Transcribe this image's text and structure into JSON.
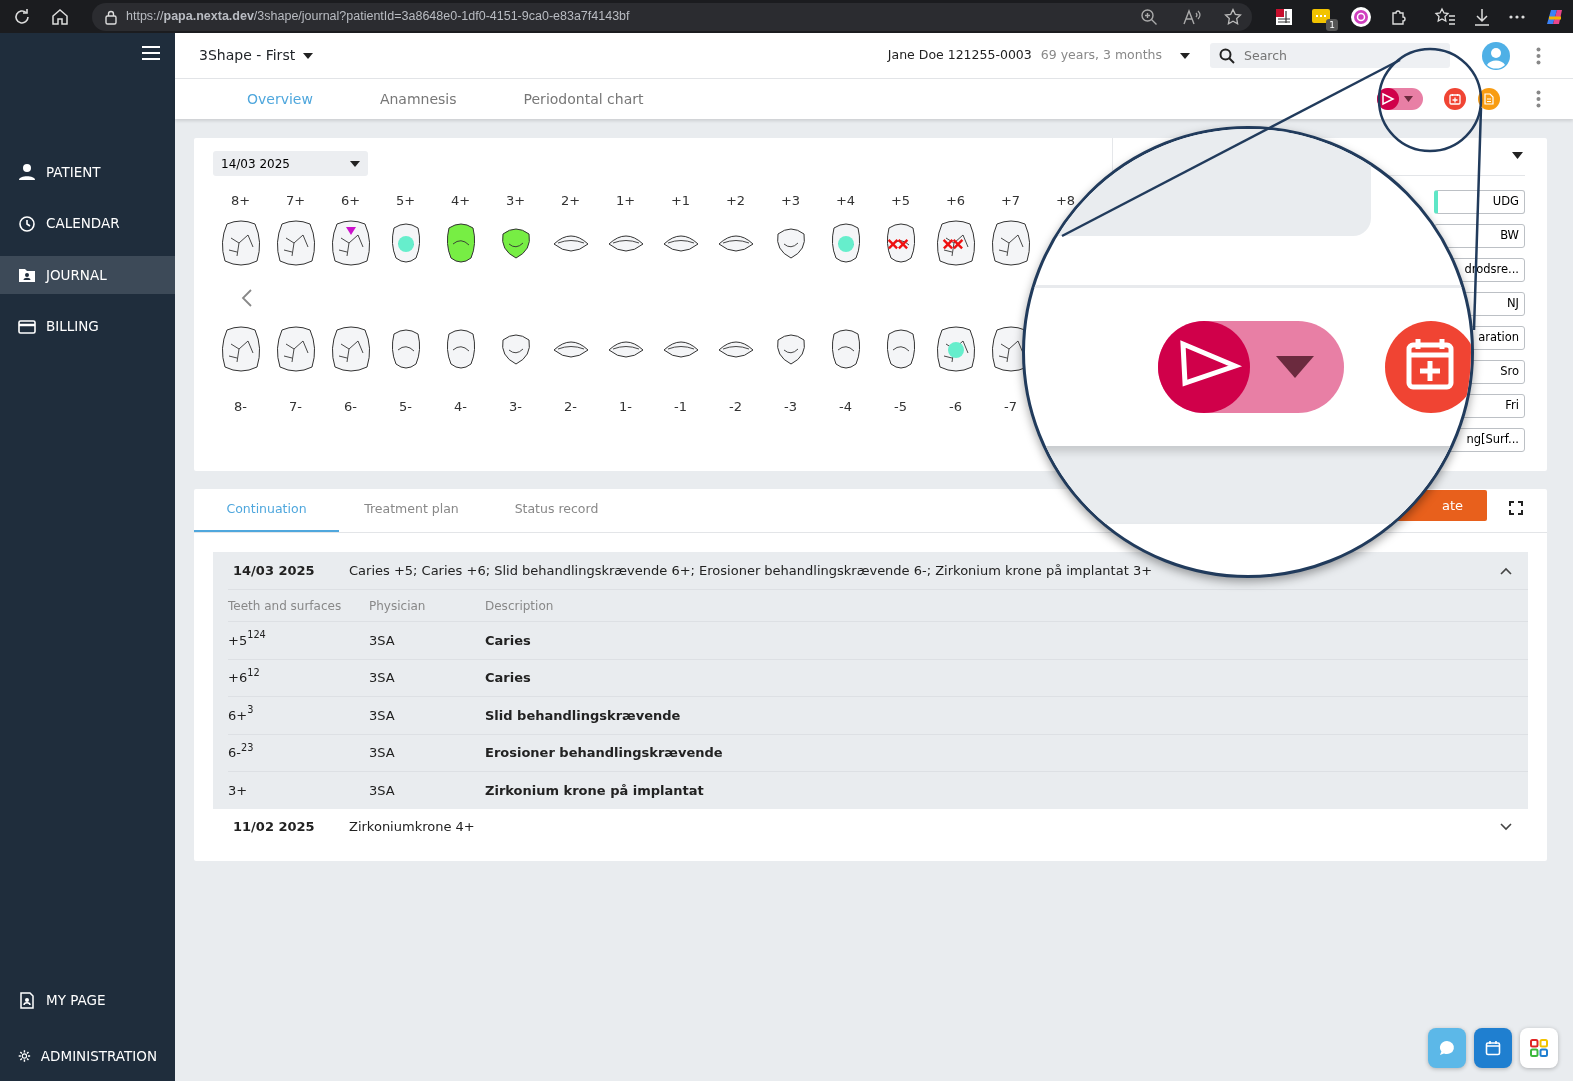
{
  "browser": {
    "url": "https://**papa.nexta.dev**/3shape/journal?patientId=3a8648e0-1df0-4151-9ca0-e83a7f4143bf",
    "extension_badge": "1"
  },
  "sidebar": {
    "items": [
      {
        "label": "PATIENT",
        "selected": false
      },
      {
        "label": "CALENDAR",
        "selected": false
      },
      {
        "label": "JOURNAL",
        "selected": true
      },
      {
        "label": "BILLING",
        "selected": false
      }
    ],
    "bottom_items": [
      {
        "label": "MY PAGE"
      },
      {
        "label": "ADMINISTRATION"
      }
    ]
  },
  "header": {
    "clinic": "3Shape - First",
    "patient_name": "Jane Doe",
    "patient_id": "121255-0003",
    "age": "69 years, 3 months",
    "search_placeholder": "Search"
  },
  "tabs": [
    {
      "label": "Overview",
      "selected": true
    },
    {
      "label": "Anamnesis",
      "selected": false
    },
    {
      "label": "Periodontal chart",
      "selected": false
    }
  ],
  "chart": {
    "date": "14/03 2025",
    "upper_labels": [
      "8+",
      "7+",
      "6+",
      "5+",
      "4+",
      "3+",
      "2+",
      "1+",
      "+1",
      "+2",
      "+3",
      "+4",
      "+5",
      "+6",
      "+7",
      "+8"
    ],
    "upper_teeth": [
      {
        "kind": "molar"
      },
      {
        "kind": "molar"
      },
      {
        "kind": "molar",
        "finding": {
          "kind": "wedge",
          "color": "#cc11cc"
        }
      },
      {
        "kind": "premolar",
        "finding": {
          "kind": "spot",
          "color": "#66eecc"
        }
      },
      {
        "kind": "premolar",
        "finding": {
          "kind": "fill",
          "color": "#77ee44"
        }
      },
      {
        "kind": "canine",
        "finding": {
          "kind": "fill",
          "color": "#77ee44"
        }
      },
      {
        "kind": "incisor"
      },
      {
        "kind": "incisor"
      },
      {
        "kind": "incisor"
      },
      {
        "kind": "incisor"
      },
      {
        "kind": "canine"
      },
      {
        "kind": "premolar",
        "finding": {
          "kind": "spot",
          "color": "#66eecc"
        }
      },
      {
        "kind": "premolar",
        "finding": {
          "kind": "cross",
          "color": "#ee1111"
        }
      },
      {
        "kind": "molar",
        "finding": {
          "kind": "cross",
          "color": "#ee1111"
        }
      },
      {
        "kind": "molar"
      }
    ],
    "lower_teeth": [
      {
        "kind": "molar"
      },
      {
        "kind": "molar"
      },
      {
        "kind": "molar"
      },
      {
        "kind": "premolar"
      },
      {
        "kind": "premolar"
      },
      {
        "kind": "canine"
      },
      {
        "kind": "incisor"
      },
      {
        "kind": "incisor"
      },
      {
        "kind": "incisor"
      },
      {
        "kind": "incisor"
      },
      {
        "kind": "canine"
      },
      {
        "kind": "premolar"
      },
      {
        "kind": "premolar"
      },
      {
        "kind": "molar",
        "finding": {
          "kind": "spot",
          "color": "#66eecc"
        }
      },
      {
        "kind": "molar"
      }
    ],
    "lower_labels": [
      "8-",
      "7-",
      "6-",
      "5-",
      "4-",
      "3-",
      "2-",
      "1-",
      "-1",
      "-2",
      "-3",
      "-4",
      "-5",
      "-6",
      "-7"
    ],
    "side_buttons": [
      {
        "label": "UDG",
        "marked": true
      },
      {
        "label": "BW",
        "marked": false
      },
      {
        "label": "drodsre...",
        "marked": false
      },
      {
        "label": "NJ",
        "marked": false
      },
      {
        "label": "aration",
        "marked": false
      },
      {
        "label": "Sro",
        "marked": false
      },
      {
        "label": "Fri",
        "marked": false
      },
      {
        "label": "ng[Surf...",
        "marked": false
      }
    ]
  },
  "journal": {
    "tabs": [
      {
        "label": "Continuation",
        "selected": true
      },
      {
        "label": "Treatment plan",
        "selected": false
      },
      {
        "label": "Status record",
        "selected": false
      }
    ],
    "action": "ate",
    "entries": [
      {
        "date": "14/03 2025",
        "summary": "Caries +5; Caries +6; Slid behandlingskrævende 6+; Erosioner behandlingskrævende 6-; Zirkonium krone på implantat 3+",
        "expanded": true,
        "columns": [
          "Teeth and surfaces",
          "Physician",
          "Description"
        ],
        "rows": [
          {
            "teeth": "+5$^{124}$",
            "physician": "3SA",
            "description": "Caries"
          },
          {
            "teeth": "+6$^{12}$",
            "physician": "3SA",
            "description": "Caries"
          },
          {
            "teeth": "6+$^{3}$",
            "physician": "3SA",
            "description": "Slid behandlingskrævende"
          },
          {
            "teeth": "6-$^{23}$",
            "physician": "3SA",
            "description": "Erosioner behandlingskrævende"
          },
          {
            "teeth": "3+",
            "physician": "3SA",
            "description": "Zirkonium krone på implantat"
          }
        ]
      },
      {
        "date": "11/02 2025",
        "summary": "Zirkoniumkrone 4+",
        "expanded": false
      }
    ]
  }
}
